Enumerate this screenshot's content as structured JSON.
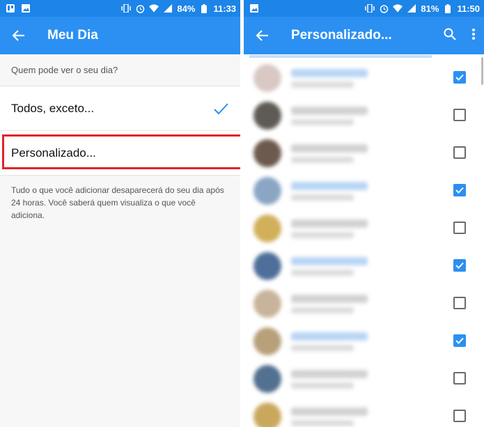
{
  "left": {
    "status": {
      "battery": "84%",
      "time": "11:33"
    },
    "appbar": {
      "title": "Meu Dia"
    },
    "section_header": "Quem pode ver o seu dia?",
    "options": [
      {
        "label": "Todos, exceto...",
        "selected": true
      },
      {
        "label": "Personalizado...",
        "selected": false
      }
    ],
    "note": "Tudo o que você adicionar desaparecerá do seu dia após 24 horas. Você saberá quem visualiza o que você adiciona."
  },
  "right": {
    "status": {
      "battery": "81%",
      "time": "11:50"
    },
    "appbar": {
      "title": "Personalizado..."
    },
    "contacts": [
      {
        "checked": true,
        "avatar_color": "#d9c8c4",
        "name_color": "#b9d5f4"
      },
      {
        "checked": false,
        "avatar_color": "#5f5a55",
        "name_color": "#d2d2d2"
      },
      {
        "checked": false,
        "avatar_color": "#6d5a4e",
        "name_color": "#d2d2d2"
      },
      {
        "checked": true,
        "avatar_color": "#8aa6c4",
        "name_color": "#b9d5f4"
      },
      {
        "checked": false,
        "avatar_color": "#d2b05a",
        "name_color": "#d2d2d2"
      },
      {
        "checked": true,
        "avatar_color": "#4f6f9a",
        "name_color": "#b9d5f4"
      },
      {
        "checked": false,
        "avatar_color": "#c8b49a",
        "name_color": "#d2d2d2"
      },
      {
        "checked": true,
        "avatar_color": "#b7a07a",
        "name_color": "#b9d5f4"
      },
      {
        "checked": false,
        "avatar_color": "#52708f",
        "name_color": "#d2d2d2"
      },
      {
        "checked": false,
        "avatar_color": "#c9a85e",
        "name_color": "#d2d2d2"
      }
    ]
  },
  "colors": {
    "primary": "#2b90f2",
    "status_bar": "#1d84e8",
    "highlight": "#e1222a",
    "check_accent": "#2b90f2"
  },
  "icons": {
    "back": "arrow-left-icon",
    "search": "search-icon",
    "more": "more-vert-icon",
    "check": "check-icon"
  }
}
